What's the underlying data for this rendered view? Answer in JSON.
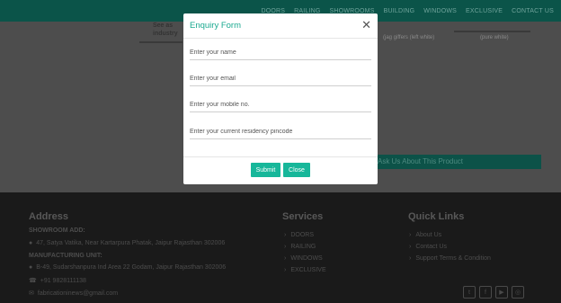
{
  "nav": {
    "items": [
      "DOORS",
      "RAILING",
      "SHOWROOMS",
      "BUILDING",
      "WINDOWS",
      "EXCLUSIVE",
      "CONTACT US"
    ]
  },
  "page": {
    "card_left_text": [
      "See as",
      "industry"
    ],
    "card_mid_caption": "(jag giffers (left white)",
    "card_right_caption": "(pure white)",
    "enquiry_bar_label": "Ask Us About This Product"
  },
  "footer": {
    "address": {
      "heading": "Address",
      "showroom_label": "SHOWROOM ADD:",
      "showroom_address": "47, Satya Vatika, Near Kartarpura Phatak, Jaipur Rajasthan 302006",
      "manufacturing_label": "MANUFACTURING UNIT:",
      "manufacturing_address": "B-49, Sudarshanpura Ind Area 22 Godam, Jaipur Rajasthan 302006",
      "phone": "+91 9828111138",
      "email": "fabricationinews@gmail.com"
    },
    "services": {
      "heading": "Services",
      "items": [
        "DOORS",
        "RAILING",
        "WINDOWS",
        "EXCLUSIVE"
      ]
    },
    "quick_links": {
      "heading": "Quick Links",
      "items": [
        "About Us",
        "Contact Us",
        "Support Terms & Condition"
      ]
    },
    "socials": [
      "twitter-icon",
      "facebook-icon",
      "youtube-icon",
      "instagram-icon"
    ]
  },
  "modal": {
    "title": "Enquiry Form",
    "close_glyph": "✕",
    "fields": {
      "name_placeholder": "Enter your name",
      "email_placeholder": "Enter your email",
      "mobile_placeholder": "Enter your mobile no.",
      "pincode_placeholder": "Enter your current residency pincode"
    },
    "submit_label": "Submit",
    "close_label": "Close"
  },
  "colors": {
    "accent": "#17b79a",
    "title_teal": "#1aa98f",
    "topbar": "#0b5449",
    "footer_bg": "#1a1a1a"
  }
}
